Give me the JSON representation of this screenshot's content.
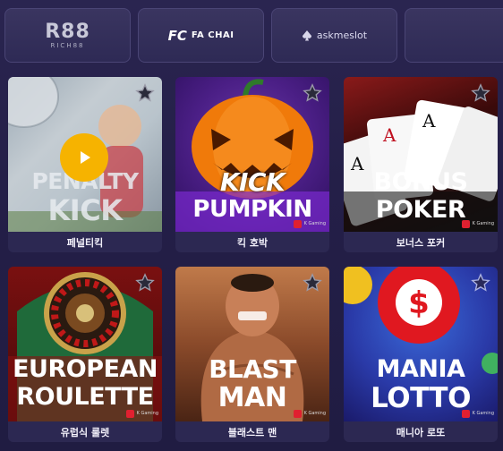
{
  "providers": [
    {
      "name": "R88",
      "sub": "RICH88"
    },
    {
      "mark": "FC",
      "name": "FA CHAI"
    },
    {
      "name": "askmeslot"
    }
  ],
  "games": [
    {
      "title_line1": "PENALTY",
      "title_line2": "KICK",
      "label": "페널티킥",
      "provider_tag": "K Gaming",
      "selected": true
    },
    {
      "title_line1": "KICK",
      "title_line2": "PUMPKIN",
      "label": "킥 호박",
      "provider_tag": "K Gaming"
    },
    {
      "title_line1": "BONUS",
      "title_line2": "POKER",
      "label": "보너스 포커",
      "provider_tag": "K Gaming"
    },
    {
      "title_line1": "EUROPEAN",
      "title_line2": "ROULETTE",
      "label": "유럽식 룰렛",
      "provider_tag": "K Gaming"
    },
    {
      "title_line1": "BLAST",
      "title_line2": "MAN",
      "label": "블래스트 맨",
      "provider_tag": "K Gaming"
    },
    {
      "title_line1": "MANIA",
      "title_line2": "LOTTO",
      "label": "매니아 로또",
      "provider_tag": "K Gaming"
    }
  ],
  "icons": {
    "favorite": "star-icon",
    "play": "play-icon"
  },
  "colors": {
    "background": "#241f48",
    "play_button": "#f6b300",
    "label_bar": "#2c2852"
  }
}
